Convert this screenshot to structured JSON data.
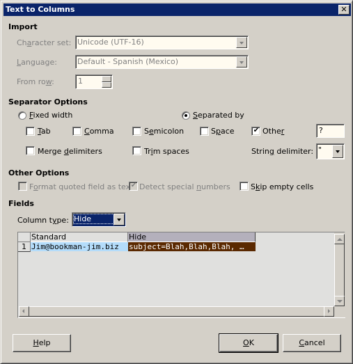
{
  "window": {
    "title": "Text to Columns",
    "close_icon": "close-icon"
  },
  "import": {
    "heading": "Import",
    "character_set": {
      "label_pre": "Ch",
      "label_u": "a",
      "label_post": "racter set:",
      "value": "Unicode (UTF-16)"
    },
    "language": {
      "label_u": "L",
      "label_post": "anguage:",
      "value": "Default - Spanish (Mexico)"
    },
    "from_row": {
      "label_pre": "From ro",
      "label_u": "w",
      "label_post": ":",
      "value": "1"
    }
  },
  "separator_options": {
    "heading": "Separator Options",
    "fixed_width": {
      "label_u": "F",
      "label_post": "ixed width",
      "selected": false
    },
    "separated_by": {
      "label_u": "S",
      "label_post": "eparated by",
      "selected": true
    },
    "tab": {
      "label_u": "T",
      "label_post": "ab",
      "checked": false
    },
    "comma": {
      "label_u": "C",
      "label_post": "omma",
      "checked": false
    },
    "semicolon": {
      "label_pre": "S",
      "label_u": "e",
      "label_post": "micolon",
      "checked": false
    },
    "space": {
      "label_pre": "S",
      "label_u": "p",
      "label_post": "ace",
      "checked": false
    },
    "other": {
      "label_pre": "Othe",
      "label_u": "r",
      "label_post": "",
      "checked": true,
      "value": "?"
    },
    "merge_delimiters": {
      "label_pre": "Merge ",
      "label_u": "d",
      "label_post": "elimiters",
      "checked": false
    },
    "trim_spaces": {
      "label_pre": "Tr",
      "label_u": "i",
      "label_post": "m spaces",
      "checked": false
    },
    "string_delimiter": {
      "label_pre": "Strin",
      "label_u": "g",
      "label_post": " delimiter:",
      "value": "\""
    }
  },
  "other_options": {
    "heading": "Other Options",
    "format_quoted": {
      "label_pre": "F",
      "label_u": "o",
      "label_post": "rmat quoted field as text",
      "checked": false,
      "enabled": false
    },
    "detect_special": {
      "label_pre": "Detect special ",
      "label_u": "n",
      "label_post": "umbers",
      "checked": true,
      "enabled": false
    },
    "skip_empty": {
      "label_pre": "S",
      "label_u": "k",
      "label_post": "ip empty cells",
      "checked": false
    }
  },
  "fields": {
    "heading": "Fields",
    "column_type": {
      "label_pre": "Column t",
      "label_u": "y",
      "label_post": "pe:",
      "value": "Hide"
    },
    "preview": {
      "columns": [
        "Standard",
        "Hide"
      ],
      "rows": [
        {
          "num": "1",
          "cells": [
            "Jim@bookman-jim.biz",
            "subject=Blah,Blah,Blah, …"
          ]
        }
      ],
      "colors": {
        "standard_bg": "#b4dcfa",
        "hide_bg": "#5a2800",
        "hide_header_bg": "#b4b0bc",
        "selection": "#0a246a"
      }
    }
  },
  "buttons": {
    "help": {
      "label_u": "H",
      "label_post": "elp"
    },
    "ok": {
      "label_u": "O",
      "label_post": "K"
    },
    "cancel": {
      "label_u": "C",
      "label_post": "ancel"
    }
  }
}
